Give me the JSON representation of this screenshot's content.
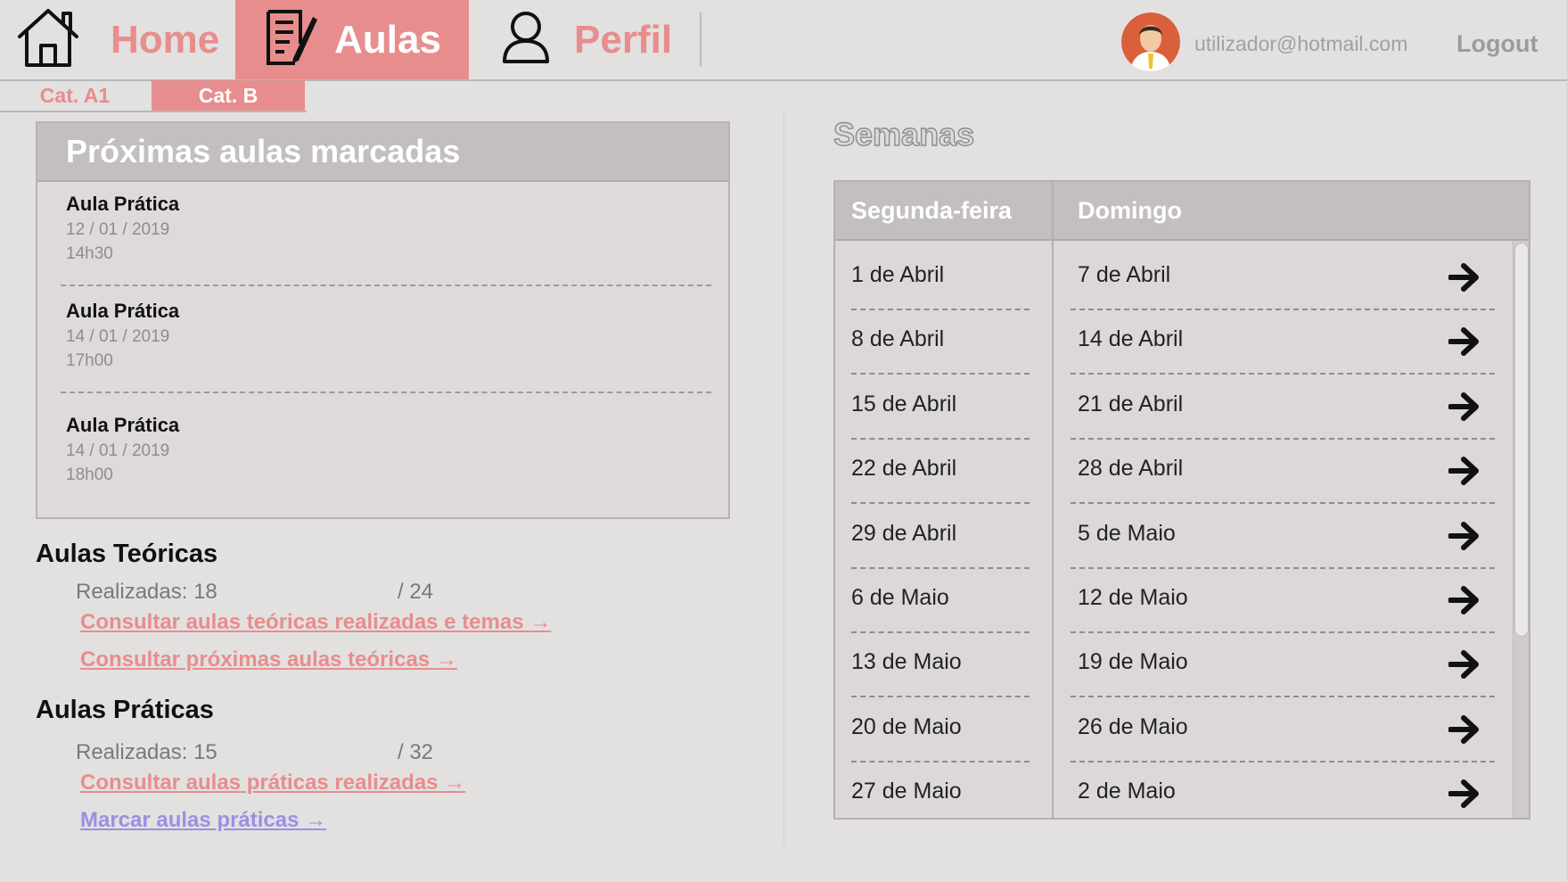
{
  "nav": {
    "home_label": "Home",
    "aulas_label": "Aulas",
    "perfil_label": "Perfil",
    "email": "utilizador@hotmail.com",
    "logout_label": "Logout"
  },
  "categories": [
    {
      "label": "Cat. A1",
      "active": false
    },
    {
      "label": "Cat. B",
      "active": true
    }
  ],
  "upcoming": {
    "title": "Próximas aulas marcadas",
    "lessons": [
      {
        "title": "Aula Prática",
        "date": "12 / 01 / 2019",
        "time": "14h30"
      },
      {
        "title": "Aula Prática",
        "date": "14 / 01 / 2019",
        "time": "17h00"
      },
      {
        "title": "Aula Prática",
        "date": "14 / 01 / 2019",
        "time": "18h00"
      }
    ]
  },
  "theory": {
    "title": "Aulas Teóricas",
    "done_label": "Realizadas: 18",
    "total_label": "/ 24",
    "done": 18,
    "total": 24,
    "link_done": "Consultar aulas teóricas realizadas e temas →",
    "link_next": "Consultar próximas aulas teóricas →"
  },
  "practice": {
    "title": "Aulas Práticas",
    "done_label": "Realizadas: 15",
    "total_label": "/ 32",
    "done": 15,
    "total": 32,
    "link_done": "Consultar aulas práticas realizadas →",
    "link_book": "Marcar aulas práticas →"
  },
  "weeks": {
    "title": "Semanas",
    "col_start": "Segunda-feira",
    "col_end": "Domingo",
    "rows": [
      {
        "start": "1 de Abril",
        "end": "7 de Abril"
      },
      {
        "start": "8 de Abril",
        "end": "14 de Abril"
      },
      {
        "start": "15 de Abril",
        "end": "21 de Abril"
      },
      {
        "start": "22 de Abril",
        "end": "28 de Abril"
      },
      {
        "start": "29 de Abril",
        "end": "5 de Maio"
      },
      {
        "start": "6 de Maio",
        "end": "12 de Maio"
      },
      {
        "start": "13 de Maio",
        "end": "19 de Maio"
      },
      {
        "start": "20 de Maio",
        "end": "26 de Maio"
      },
      {
        "start": "27 de Maio",
        "end": "2 de Maio"
      }
    ]
  },
  "colors": {
    "accent": "#e88d8d",
    "link_purple": "#9a90e2",
    "background": "#e3e0e0",
    "header_gray": "#c3bfbf"
  },
  "icons": {
    "home": "home-icon",
    "aulas": "document-edit-icon",
    "perfil": "user-icon",
    "row_action": "arrow-right-icon"
  }
}
